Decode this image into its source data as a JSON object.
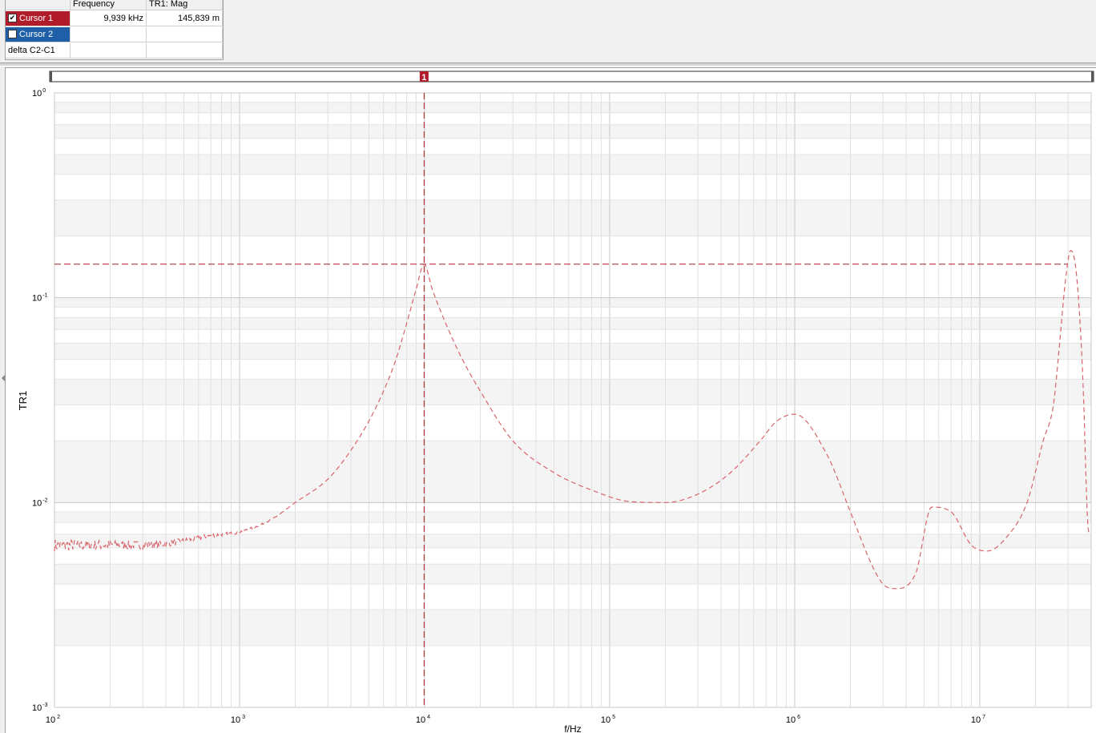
{
  "cursor_table": {
    "headers": [
      "",
      "Frequency",
      "TR1: Mag"
    ],
    "rows": [
      {
        "label": "Cursor 1",
        "checked": true,
        "frequency": "9,939 kHz",
        "mag": "145,839 m"
      },
      {
        "label": "Cursor 2",
        "checked": false,
        "frequency": "",
        "mag": ""
      },
      {
        "label": "delta C2-C1",
        "checked": null,
        "frequency": "",
        "mag": ""
      }
    ],
    "colors": {
      "cursor1": "#b01c2a",
      "cursor2": "#1e5fa8"
    }
  },
  "plot": {
    "cursor_marker_label": "1",
    "ylabel": "TR1",
    "xlabel": "f/Hz",
    "trace_color": "#d9646b",
    "cursor_color": "#b01c2a"
  },
  "chart_data": {
    "type": "line",
    "x_scale": "log",
    "y_scale": "log",
    "xlim": [
      100,
      40000000
    ],
    "ylim": [
      0.001,
      1
    ],
    "x_ticks": [
      {
        "value": 100,
        "base": "10",
        "exp": "2"
      },
      {
        "value": 1000,
        "base": "10",
        "exp": "3"
      },
      {
        "value": 10000,
        "base": "10",
        "exp": "4"
      },
      {
        "value": 100000,
        "base": "10",
        "exp": "5"
      },
      {
        "value": 1000000,
        "base": "10",
        "exp": "6"
      },
      {
        "value": 10000000,
        "base": "10",
        "exp": "7"
      }
    ],
    "y_ticks": [
      {
        "value": 1,
        "base": "10",
        "exp": "0"
      },
      {
        "value": 0.1,
        "base": "10",
        "exp": "-1"
      },
      {
        "value": 0.01,
        "base": "10",
        "exp": "-2"
      },
      {
        "value": 0.001,
        "base": "10",
        "exp": "-3"
      }
    ],
    "grid": true,
    "cursor": {
      "x": 9939,
      "y": 0.145839
    },
    "series": [
      {
        "line_style": "dashed",
        "x": [
          100,
          150,
          200,
          300,
          400,
          500,
          700,
          1000,
          1500,
          2000,
          3000,
          4000,
          5000,
          6000,
          7000,
          8000,
          9000,
          9939,
          11000,
          13000,
          16000,
          20000,
          30000,
          50000,
          80000,
          130000,
          200000,
          300000,
          450000,
          650000,
          800000,
          1000000,
          1500000,
          2000000,
          2600000,
          3000000,
          3500000,
          4500000,
          5500000,
          7000000,
          9000000,
          11000000,
          14000000,
          18000000,
          22000000,
          25000000,
          27000000,
          29000000,
          31000000,
          33000000,
          35000000,
          36500000,
          37500000,
          38500000,
          39500000
        ],
        "y": [
          0.0062,
          0.0062,
          0.0062,
          0.0062,
          0.0063,
          0.0065,
          0.0069,
          0.0072,
          0.0083,
          0.01,
          0.013,
          0.018,
          0.025,
          0.035,
          0.05,
          0.075,
          0.11,
          0.1458,
          0.11,
          0.075,
          0.05,
          0.035,
          0.02,
          0.014,
          0.0115,
          0.0101,
          0.01,
          0.011,
          0.014,
          0.02,
          0.025,
          0.027,
          0.017,
          0.009,
          0.005,
          0.004,
          0.0038,
          0.0045,
          0.0095,
          0.009,
          0.0062,
          0.0058,
          0.0068,
          0.01,
          0.02,
          0.03,
          0.06,
          0.12,
          0.17,
          0.14,
          0.07,
          0.03,
          0.013,
          0.0075,
          0.007
        ]
      }
    ]
  }
}
